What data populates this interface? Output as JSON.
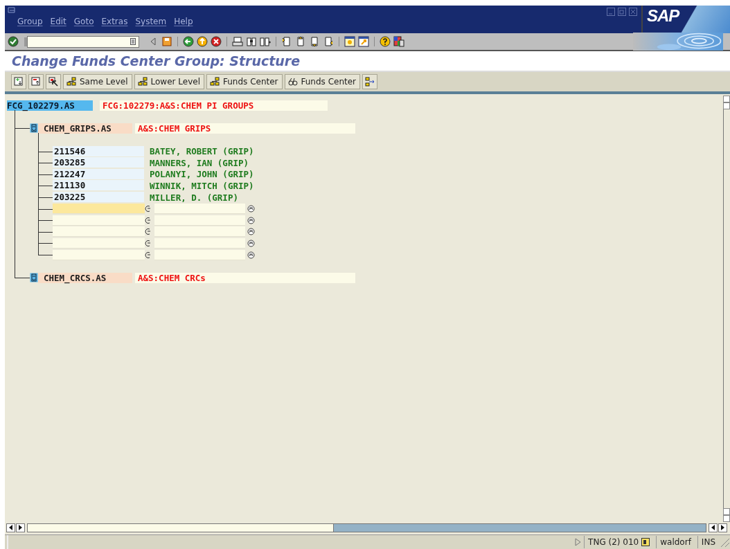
{
  "menu": [
    "Group",
    "Edit",
    "Goto",
    "Extras",
    "System",
    "Help"
  ],
  "logo": "SAP",
  "screen_title": "Change Funds Center Group: Structure",
  "app_toolbar": [
    {
      "label": "Same Level"
    },
    {
      "label": "Lower Level"
    },
    {
      "label": "Funds Center"
    },
    {
      "label": "Funds Center"
    }
  ],
  "tree": {
    "key": "FCG_102279.AS",
    "description": "FCG:102279:A&S:CHEM PI GROUPS",
    "children": [
      {
        "kind": "group",
        "key": "CHEM_GRIPS.AS",
        "description": "A&S:CHEM GRIPS",
        "children": [
          {
            "kind": "funds_center",
            "key": "211546",
            "description": "BATEY, ROBERT (GRIP)"
          },
          {
            "kind": "funds_center",
            "key": "203285",
            "description": "MANNERS, IAN (GRIP)"
          },
          {
            "kind": "funds_center",
            "key": "212247",
            "description": "POLANYI, JOHN (GRIP)"
          },
          {
            "kind": "funds_center",
            "key": "211130",
            "description": "WINNIK, MITCH (GRIP)"
          },
          {
            "kind": "funds_center",
            "key": "203225",
            "description": "MILLER, D. (GRIP)"
          },
          {
            "kind": "input",
            "focused": true
          },
          {
            "kind": "input",
            "focused": false
          },
          {
            "kind": "input",
            "focused": false
          },
          {
            "kind": "input",
            "focused": false
          },
          {
            "kind": "input",
            "focused": false
          }
        ]
      },
      {
        "kind": "group",
        "key": "CHEM_CRCS.AS",
        "description": "A&S:CHEM CRCs"
      }
    ]
  },
  "status_bar": {
    "system": "TNG (2) 010",
    "server": "waldorf",
    "mode": "INS"
  }
}
